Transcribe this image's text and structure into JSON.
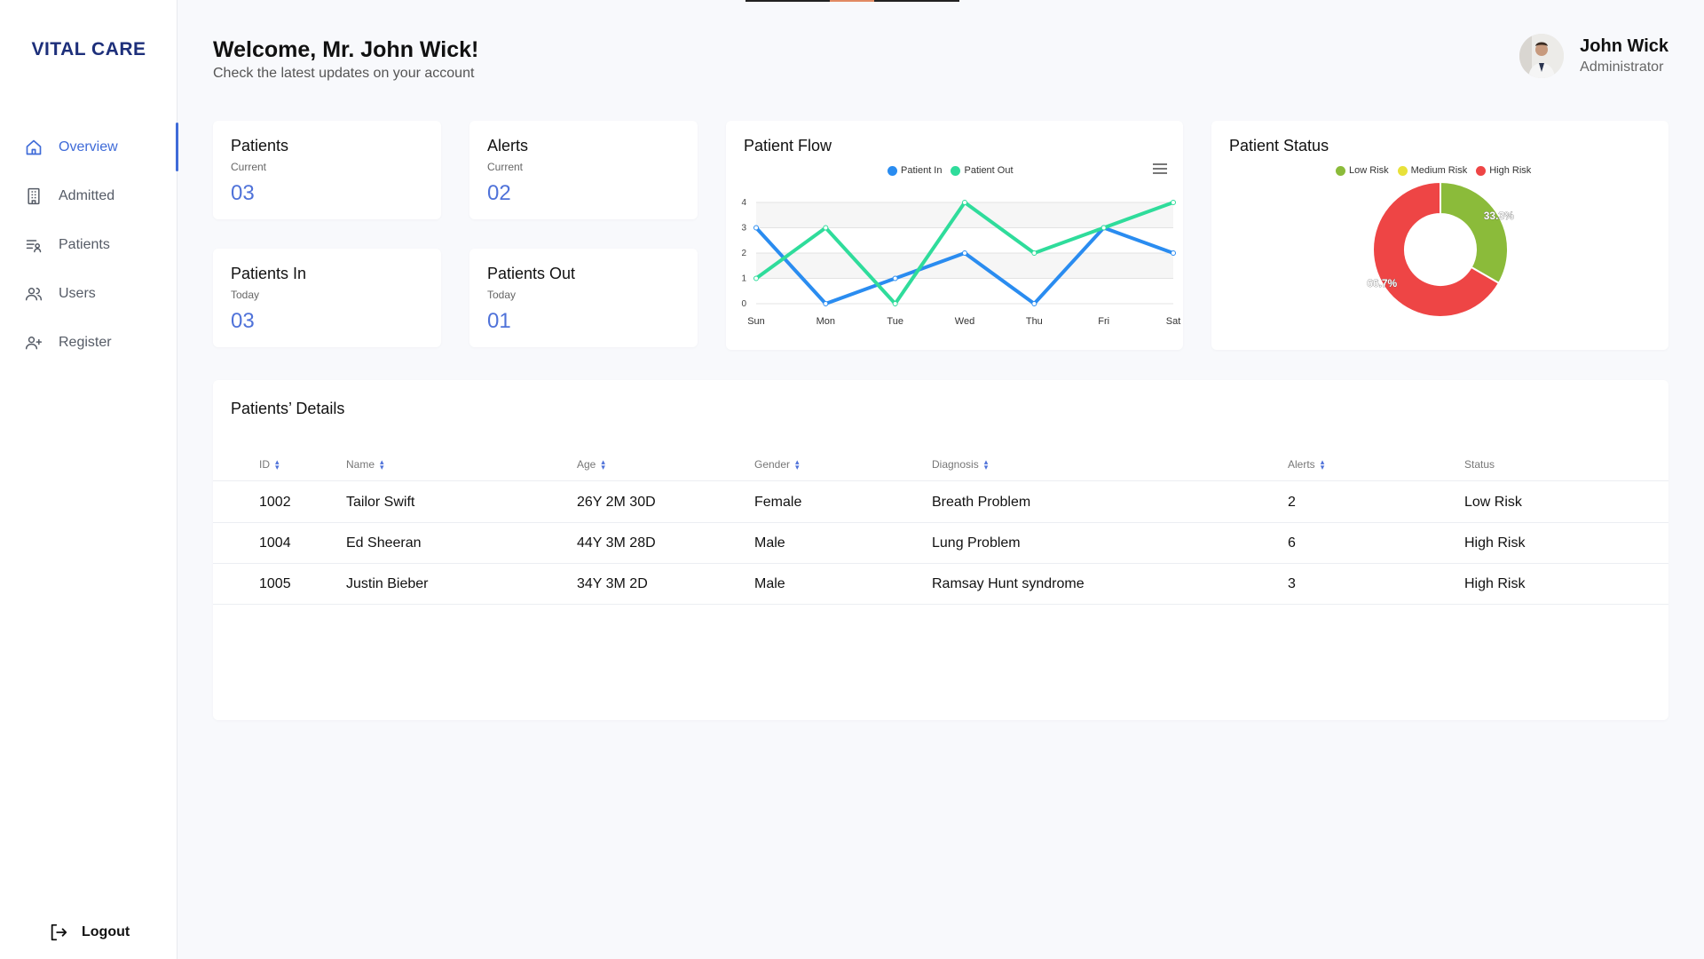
{
  "brand": "VITAL CARE",
  "nav": [
    {
      "label": "Overview",
      "icon": "home-icon",
      "active": true
    },
    {
      "label": "Admitted",
      "icon": "building-icon",
      "active": false
    },
    {
      "label": "Patients",
      "icon": "list-user-icon",
      "active": false
    },
    {
      "label": "Users",
      "icon": "users-icon",
      "active": false
    },
    {
      "label": "Register",
      "icon": "user-add-icon",
      "active": false
    }
  ],
  "logout_label": "Logout",
  "header": {
    "welcome": "Welcome, Mr. John Wick!",
    "subtitle": "Check the latest updates on your account"
  },
  "profile": {
    "name": "John Wick",
    "role": "Administrator"
  },
  "stats": [
    {
      "title": "Patients",
      "sub": "Current",
      "value": "03"
    },
    {
      "title": "Alerts",
      "sub": "Current",
      "value": "02"
    },
    {
      "title": "Patients In",
      "sub": "Today",
      "value": "03"
    },
    {
      "title": "Patients Out",
      "sub": "Today",
      "value": "01"
    }
  ],
  "flow_title": "Patient Flow",
  "status_title": "Patient Status",
  "chart_data": [
    {
      "type": "line",
      "title": "Patient Flow",
      "categories": [
        "Sun",
        "Mon",
        "Tue",
        "Wed",
        "Thu",
        "Fri",
        "Sat"
      ],
      "series": [
        {
          "name": "Patient In",
          "color": "#2a8cf0",
          "values": [
            3,
            0,
            1,
            2,
            0,
            3,
            2
          ]
        },
        {
          "name": "Patient Out",
          "color": "#2fdc9b",
          "values": [
            1,
            3,
            0,
            4,
            2,
            3,
            4
          ]
        }
      ],
      "ylim": [
        0,
        4
      ],
      "yticks": [
        "0",
        "1",
        "2",
        "3",
        "4"
      ],
      "grid": true,
      "legend": "top-center"
    },
    {
      "type": "pie",
      "title": "Patient Status",
      "donut": true,
      "legend": "top-center",
      "slices": [
        {
          "name": "Low Risk",
          "color": "#8bbb3a",
          "value": 33.3,
          "label": "33.3%"
        },
        {
          "name": "Medium Risk",
          "color": "#e8e13a",
          "value": 0,
          "label": ""
        },
        {
          "name": "High Risk",
          "color": "#ee4545",
          "value": 66.7,
          "label": "66.7%"
        }
      ]
    }
  ],
  "table": {
    "title": "Patients’ Details",
    "columns": [
      "ID",
      "Name",
      "Age",
      "Gender",
      "Diagnosis",
      "Alerts",
      "Status"
    ],
    "sortable": [
      true,
      true,
      true,
      true,
      true,
      true,
      false
    ],
    "rows": [
      [
        "1002",
        "Tailor Swift",
        "26Y 2M 30D",
        "Female",
        "Breath Problem",
        "2",
        "Low Risk"
      ],
      [
        "1004",
        "Ed Sheeran",
        "44Y 3M 28D",
        "Male",
        "Lung Problem",
        "6",
        "High Risk"
      ],
      [
        "1005",
        "Justin Bieber",
        "34Y 3M 2D",
        "Male",
        "Ramsay Hunt syndrome",
        "3",
        "High Risk"
      ]
    ]
  }
}
